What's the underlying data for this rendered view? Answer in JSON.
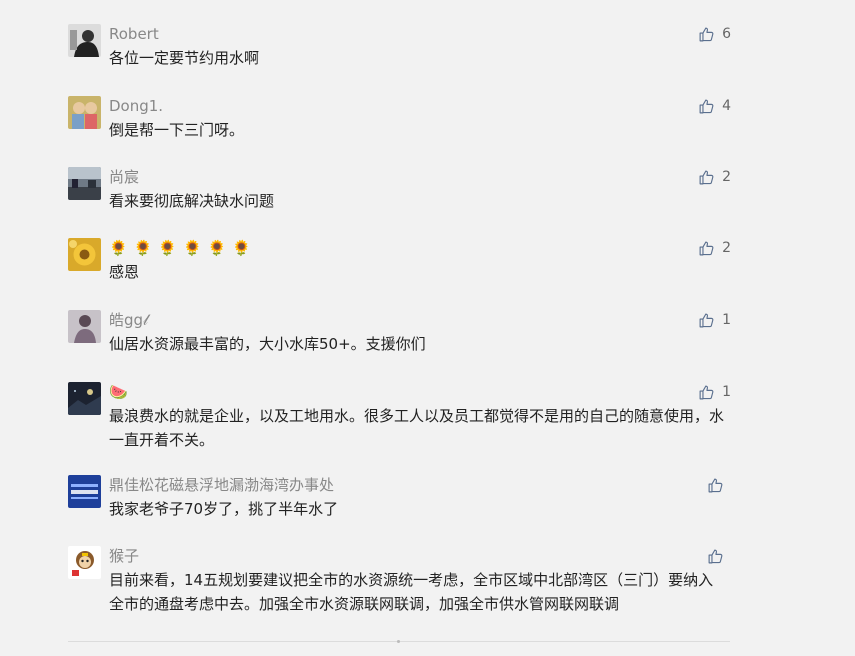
{
  "comments": [
    {
      "nickname": "Robert",
      "content": "各位一定要节约用水啊",
      "likes": "6",
      "like_icon": "thumbs-up-icon"
    },
    {
      "nickname": "Dong1.",
      "content": "倒是帮一下三门呀。",
      "likes": "4",
      "like_icon": "thumbs-up-icon"
    },
    {
      "nickname": "尚宸",
      "content": "看来要彻底解决缺水问题",
      "likes": "2",
      "like_icon": "thumbs-up-icon"
    },
    {
      "nickname": "🌻🌻🌻🌻🌻🌻",
      "content": "感恩",
      "likes": "2",
      "like_icon": "thumbs-up-icon"
    },
    {
      "nickname": "皓gg𝓁",
      "content": "仙居水资源最丰富的，大小水库50+。支援你们",
      "likes": "1",
      "like_icon": "thumbs-up-icon"
    },
    {
      "nickname": "🍉",
      "content": "最浪费水的就是企业，以及工地用水。很多工人以及员工都觉得不是用的自己的随意使用，水一直开着不关。",
      "likes": "1",
      "like_icon": "thumbs-up-icon"
    },
    {
      "nickname": "鼎佳松花磁悬浮地漏渤海湾办事处",
      "content": "我家老爷子70岁了，挑了半年水了",
      "likes": "",
      "like_icon": "thumbs-up-icon"
    },
    {
      "nickname": "猴子",
      "content": "目前来看，14五规划要建议把全市的水资源统一考虑，全市区域中北部湾区（三门）要纳入全市的通盘考虑中去。加强全市水资源联网联调，加强全市供水管网联网联调",
      "likes": "",
      "like_icon": "thumbs-up-icon"
    }
  ],
  "colors": {
    "background": "#f2f2f2",
    "nickname": "#888888",
    "content": "#222222",
    "like_icon": "#5a6f8e"
  }
}
